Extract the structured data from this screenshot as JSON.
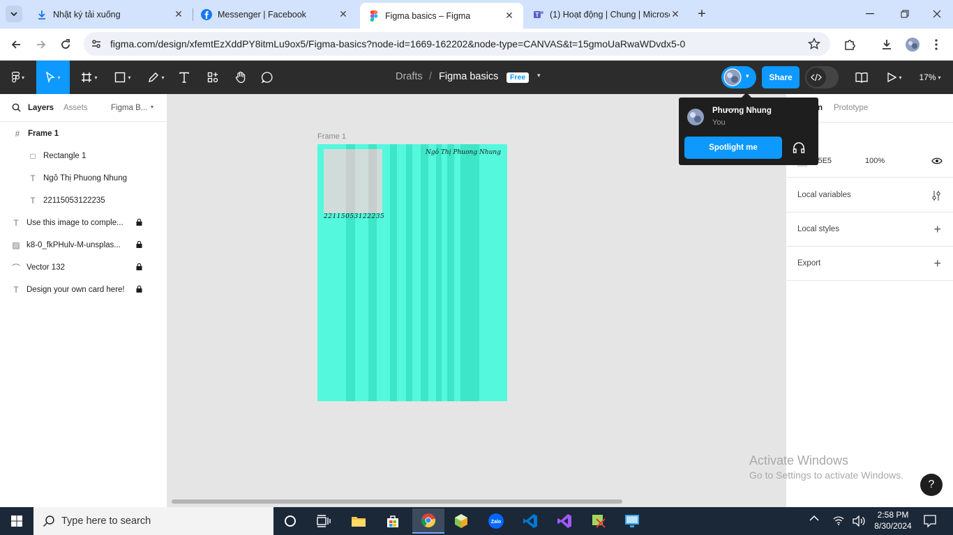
{
  "browser": {
    "tabs": [
      {
        "title": "Nhật ký tải xuống",
        "icon": "download-icon",
        "active": false
      },
      {
        "title": "Messenger | Facebook",
        "icon": "facebook-icon",
        "active": false
      },
      {
        "title": "Figma basics – Figma",
        "icon": "figma-icon",
        "active": true
      },
      {
        "title": "(1) Hoạt động | Chung | Microsoft Teams",
        "icon": "teams-icon",
        "active": false
      }
    ],
    "url": "figma.com/design/xfemtEzXddPY8itmLu9ox5/Figma-basics?node-id=1669-162202&node-type=CANVAS&t=15gmoUaRwaWDvdx5-0"
  },
  "figma": {
    "breadcrumb_root": "Drafts",
    "breadcrumb_sep": "/",
    "file_name": "Figma basics",
    "plan_badge": "Free",
    "share_label": "Share",
    "zoom": "17%",
    "left_tabs": {
      "layers": "Layers",
      "assets": "Assets",
      "page": "Figma B..."
    },
    "layers": [
      {
        "name": "Frame 1",
        "icon": "#",
        "depth": 0,
        "locked": false,
        "bold": true
      },
      {
        "name": "Rectangle 1",
        "icon": "□",
        "depth": 1,
        "locked": false
      },
      {
        "name": "Ngô Thị Phuong Nhung",
        "icon": "T",
        "depth": 1,
        "locked": false
      },
      {
        "name": "22115053122235",
        "icon": "T",
        "depth": 1,
        "locked": false
      },
      {
        "name": "Use this image to comple...",
        "icon": "T",
        "depth": 0,
        "locked": true
      },
      {
        "name": "k8-0_fkPHulv-M-unsplas...",
        "icon": "▨",
        "depth": 0,
        "locked": true
      },
      {
        "name": "Vector 132",
        "icon": "⌒",
        "depth": 0,
        "locked": true
      },
      {
        "name": "Design your own card here!",
        "icon": "T",
        "depth": 0,
        "locked": true
      }
    ],
    "canvas": {
      "frame_label": "Frame 1",
      "card_name": "Ngô Thị Phuong Nhung",
      "card_id": "22115053122235",
      "frame_color": "#54f8dd"
    },
    "right_tabs": {
      "design": "n",
      "prototype": "Prototype"
    },
    "page_fill": {
      "hex": "5E5E5",
      "opacity": "100%"
    },
    "sections": [
      "Local variables",
      "Local styles",
      "Export"
    ],
    "popover": {
      "name": "Phương Nhung",
      "sub": "You",
      "spotlight": "Spotlight me"
    },
    "watermark": {
      "line1": "Activate Windows",
      "line2": "Go to Settings to activate Windows."
    },
    "help": "?"
  },
  "taskbar": {
    "search_placeholder": "Type here to search",
    "time": "2:58 PM",
    "date": "8/30/2024"
  },
  "colors": {
    "accent": "#0d99ff",
    "toolbar": "#2c2c2c",
    "tabstrip": "#d3e3fd"
  }
}
